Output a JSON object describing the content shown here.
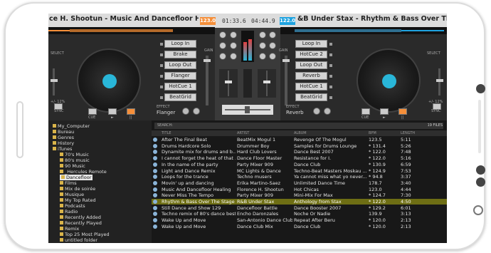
{
  "deck_left": {
    "title": "ce H. Shootun - Music And Dancefloor Heali",
    "bpm": "123.0",
    "buttons": [
      "Loop In",
      "Brake",
      "Loop Out",
      "Flanger",
      "HotCue 1",
      "BeatGrid"
    ],
    "effect_label": "EFFECT",
    "effect_value": "Flanger",
    "select": "SELECT",
    "gain": "GAIN",
    "pitch": "+/- 12%",
    "sync": "SYNC",
    "cue": "CUE",
    "play": "►",
    "pause": "||",
    "in": "IN"
  },
  "deck_right": {
    "title": "&B Under Stax - Rhythm & Bass Over The S",
    "bpm": "122.0",
    "buttons": [
      "Loop In",
      "HotCue 2",
      "Loop Out",
      "Reverb",
      "HotCue 1",
      "BeatGrid"
    ],
    "effect_label": "EFFECT",
    "effect_value": "Reverb",
    "select": "SELECT",
    "gain": "GAIN",
    "pitch": "+/- 12%",
    "sync": "SYNC",
    "cue": "CUE",
    "play": "►",
    "pause": "||",
    "in": "IN"
  },
  "mixer": {
    "time_left": "01:33.6",
    "time_right": "04:44.9"
  },
  "browser": {
    "tree": [
      {
        "label": "My_Computer",
        "indent": 0
      },
      {
        "label": "Bureau",
        "indent": 0
      },
      {
        "label": "Genres",
        "indent": 0
      },
      {
        "label": "History",
        "indent": 0
      },
      {
        "label": "iTunes",
        "indent": 0
      },
      {
        "label": "70's Music",
        "indent": 2
      },
      {
        "label": "80's music",
        "indent": 2
      },
      {
        "label": "90 Music",
        "indent": 2
      },
      {
        "label": "_Hercules Remote",
        "indent": 2
      },
      {
        "label": "Dancefloor",
        "indent": 2,
        "highlight": true
      },
      {
        "label": "Films",
        "indent": 2
      },
      {
        "label": "Mix de soirée",
        "indent": 2
      },
      {
        "label": "Musique",
        "indent": 2
      },
      {
        "label": "My Top Rated",
        "indent": 2
      },
      {
        "label": "Podcasts",
        "indent": 2
      },
      {
        "label": "Radio",
        "indent": 2
      },
      {
        "label": "Recently Added",
        "indent": 2
      },
      {
        "label": "Recently Played",
        "indent": 2
      },
      {
        "label": "Remix",
        "indent": 2
      },
      {
        "label": "Top 25 Most Played",
        "indent": 2
      },
      {
        "label": "untitled folder",
        "indent": 2
      }
    ],
    "search_label": "SEARCH:",
    "file_count": "19 FILES",
    "columns": [
      "TITLE",
      "ARTIST",
      "ALBUM",
      "BPM",
      "LENGTH"
    ],
    "tracks": [
      [
        "After The Final Beat",
        "BeatMix Mogul 1",
        "Revenge Of The Mogul",
        "123.5",
        "5:11"
      ],
      [
        "Drums Hardcore Solo",
        "Drummer Boy",
        "Samples for Drums Lounge",
        "* 131.4",
        "5:26"
      ],
      [
        "Dynamite mix for drums and b...",
        "Hard Club Lovers",
        "Dance Best 2007",
        "* 122.0",
        "7:48"
      ],
      [
        "I cannot forget the heat of that ...",
        "Dance Floor Master",
        "Resistance for I.",
        "* 122.0",
        "5:16"
      ],
      [
        "In the name of the party",
        "Party Mixer 909",
        "Dance Club",
        "* 130.9",
        "6:59"
      ],
      [
        "Light and Dance Remix",
        "MC Lights & Dance",
        "Techno-Beat Masters Moskau ...",
        "* 124.9",
        "7:53"
      ],
      [
        "Loops for the trance",
        "Techno musers",
        "Ya cannot miss what yo never...",
        "* 94.8",
        "3:37"
      ],
      [
        "Movin' up and dancing",
        "Erika Martino-Saez",
        "Unlimited Dance Time",
        "178.7",
        "3:40"
      ],
      [
        "Music And Dancefloor Healing",
        "Florence H. Shootun",
        "Hot Chicas",
        "123.0",
        "4:44"
      ],
      [
        "Never Miss The Tempo",
        "Party Mixer 909",
        "Mini-Mix For Max",
        "* 124.7",
        "7:30"
      ],
      [
        "Rhythm & Bass Over The Stage",
        "R&B Under Stax",
        "Anthology from Stax",
        "* 122.0",
        "4:50"
      ],
      [
        "Still Dance and Show 129",
        "Dancefloor Battle",
        "Dance Booster 2007",
        "* 129.2",
        "6:01"
      ],
      [
        "Techno remix of 80's dance best",
        "Encho Daronzales",
        "Noche Or Nadie",
        "139.9",
        "3:13"
      ],
      [
        "Wake Up and Move",
        "San-Antonio Dance Club",
        "Repeat After Beru",
        "* 120.0",
        "2:13"
      ],
      [
        "Wake Up and Move",
        "Dance Club Mix",
        "Dance Club",
        "* 120.0",
        "2:13"
      ]
    ],
    "selected_row": 10
  },
  "colors": {
    "accent": "#f58f3a",
    "blue": "#1fa3e0",
    "selected": "#6e6e14"
  }
}
